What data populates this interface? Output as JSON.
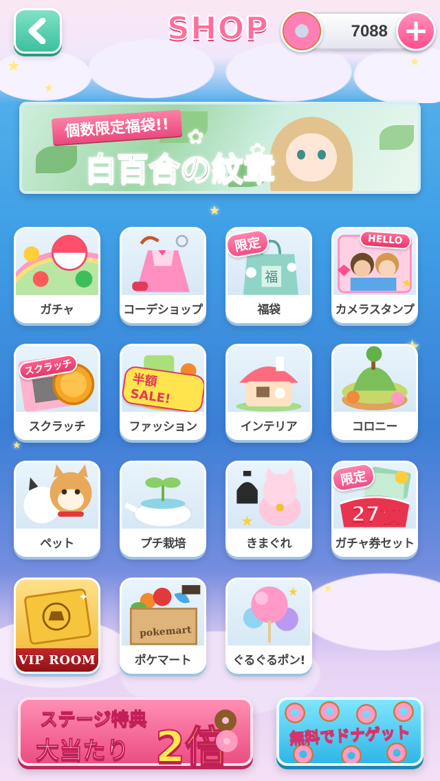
{
  "header": {
    "title": "SHOP",
    "currency_value": "7088",
    "plus_symbol": "+"
  },
  "banner": {
    "tag": "個数限定福袋!!",
    "title": "白百合の紋章"
  },
  "ribbons": {
    "limited": "限定"
  },
  "tiles": [
    {
      "label": "ガチャ",
      "icon": "gacha-capsule-icon"
    },
    {
      "label": "コーデショップ",
      "icon": "outfit-dress-icon"
    },
    {
      "label": "福袋",
      "icon": "lucky-bag-icon",
      "ribbon": "限定"
    },
    {
      "label": "カメラスタンプ",
      "icon": "camera-stamp-icon",
      "art_text": "HELLO"
    },
    {
      "label": "スクラッチ",
      "icon": "scratch-card-icon",
      "art_text": "スクラッチ"
    },
    {
      "label": "ファッション",
      "icon": "fashion-sale-icon",
      "art_text": "半額SALE!"
    },
    {
      "label": "インテリア",
      "icon": "interior-house-icon"
    },
    {
      "label": "コロニー",
      "icon": "colony-island-icon"
    },
    {
      "label": "ペット",
      "icon": "pet-dog-cat-icon"
    },
    {
      "label": "プチ栽培",
      "icon": "sprout-teapot-icon"
    },
    {
      "label": "きまぐれ",
      "icon": "lucky-cat-icon"
    },
    {
      "label": "ガチャ券セット",
      "icon": "gacha-ticket-icon",
      "ribbon": "限定",
      "art_text": "27枚"
    },
    {
      "label": "VIP ROOM",
      "icon": "vip-card-icon"
    },
    {
      "label": "ポケマート",
      "icon": "pokemart-crate-icon",
      "art_text": "pokemart"
    },
    {
      "label": "ぐるぐるポン!",
      "icon": "cotton-candy-icon"
    }
  ],
  "stage_banner": {
    "line1": "ステージ特典",
    "line2": "大当たり",
    "multiplier": "2倍"
  },
  "free_button": {
    "label": "無料でドナゲット"
  },
  "colors": {
    "accent_pink": "#ff6f9c",
    "mint": "#3cc09e",
    "sky": "#3f9fe6"
  }
}
